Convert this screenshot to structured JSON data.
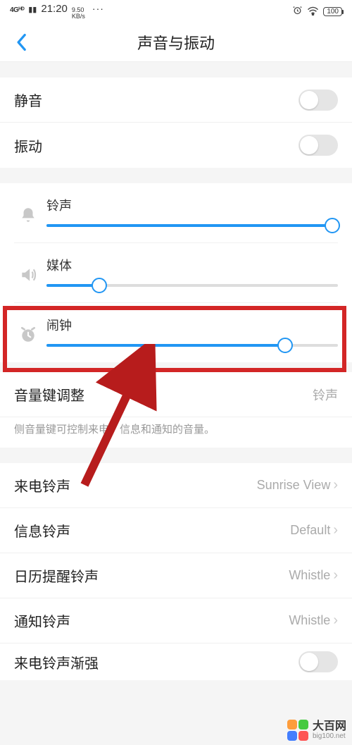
{
  "status": {
    "net": "4Gᴴᴰ",
    "time": "21:20",
    "rate_top": "9.50",
    "rate_bot": "KB/s",
    "dots": "···",
    "batt": "100"
  },
  "header": {
    "title": "声音与振动"
  },
  "toggles": {
    "mute": "静音",
    "vibrate": "振动"
  },
  "sliders": {
    "ring": {
      "label": "铃声",
      "pct": 98
    },
    "media": {
      "label": "媒体",
      "pct": 18
    },
    "alarm": {
      "label": "闹钟",
      "pct": 82
    }
  },
  "volkey": {
    "label": "音量键调整",
    "value": "铃声",
    "desc": "侧音量键可控制来电、信息和通知的音量。"
  },
  "tones": {
    "incoming": {
      "label": "来电铃声",
      "value": "Sunrise View"
    },
    "message": {
      "label": "信息铃声",
      "value": "Default"
    },
    "calendar": {
      "label": "日历提醒铃声",
      "value": "Whistle"
    },
    "notify": {
      "label": "通知铃声",
      "value": "Whistle"
    },
    "ramp": {
      "label": "来电铃声渐强"
    }
  },
  "watermark": {
    "name": "大百网",
    "url": "big100.net"
  }
}
